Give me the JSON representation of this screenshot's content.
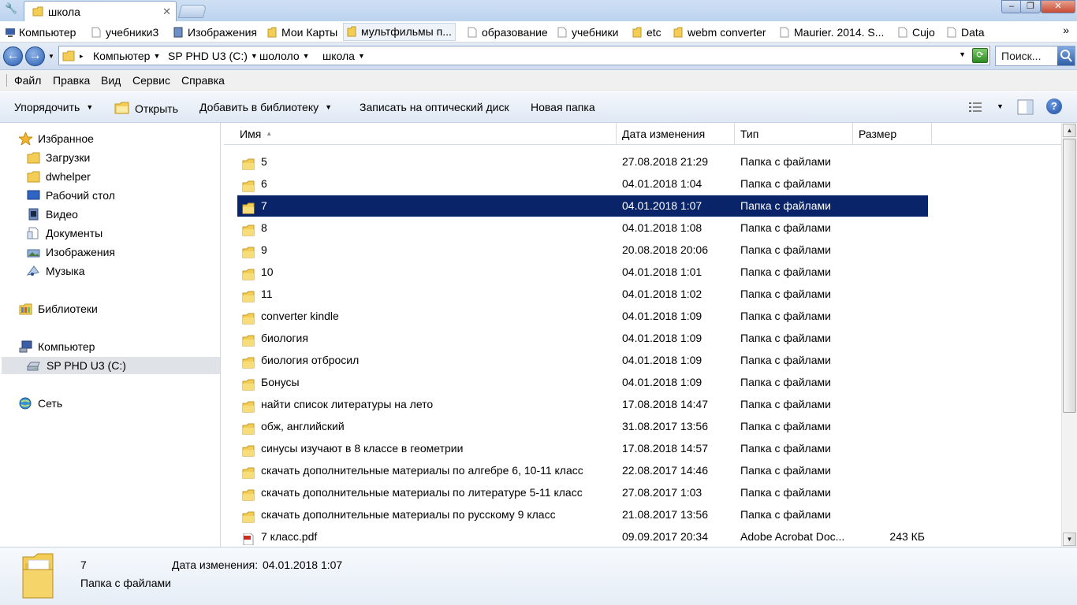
{
  "tab": {
    "title": "школа"
  },
  "bookmarks": [
    {
      "label": "Компьютер",
      "icon": "computer-icon"
    },
    {
      "label": "учебники3",
      "icon": "page-icon"
    },
    {
      "label": "Изображения",
      "icon": "pictures-icon"
    },
    {
      "label": "Мои Карты",
      "icon": "folder-icon"
    },
    {
      "label": "мультфильмы п...",
      "icon": "folder-icon"
    },
    {
      "label": "образование",
      "icon": "page-icon"
    },
    {
      "label": "учебники",
      "icon": "page-icon"
    },
    {
      "label": "etc",
      "icon": "folder-icon"
    },
    {
      "label": "webm converter",
      "icon": "folder-icon"
    },
    {
      "label": "Maurier. 2014. S...",
      "icon": "page-icon"
    },
    {
      "label": "Cujo",
      "icon": "page-icon"
    },
    {
      "label": "Data",
      "icon": "page-icon"
    }
  ],
  "bookmarks_more": "»",
  "address": {
    "crumbs": [
      "Компьютер",
      "SP PHD U3 (C:)",
      "шололо",
      "школа"
    ],
    "search_placeholder": "Поиск..."
  },
  "menu": [
    "Файл",
    "Правка",
    "Вид",
    "Сервис",
    "Справка"
  ],
  "commands": {
    "organize": "Упорядочить",
    "open": "Открыть",
    "add_library": "Добавить в библиотеку",
    "burn": "Записать на оптический диск",
    "new_folder": "Новая папка",
    "help": "?"
  },
  "nav": {
    "favorites": "Избранное",
    "favorites_items": [
      "Загрузки",
      "dwhelper",
      "Рабочий стол",
      "Видео",
      "Документы",
      "Изображения",
      "Музыка"
    ],
    "libraries": "Библиотеки",
    "computer": "Компьютер",
    "drive": "SP PHD U3 (C:)",
    "network": "Сеть"
  },
  "columns": {
    "name": "Имя",
    "date": "Дата изменения",
    "type": "Тип",
    "size": "Размер"
  },
  "files": [
    {
      "name": "5",
      "date": "27.08.2018 21:29",
      "type": "Папка с файлами",
      "size": "",
      "kind": "folder"
    },
    {
      "name": "6",
      "date": "04.01.2018 1:04",
      "type": "Папка с файлами",
      "size": "",
      "kind": "folder"
    },
    {
      "name": "7",
      "date": "04.01.2018 1:07",
      "type": "Папка с файлами",
      "size": "",
      "kind": "folder",
      "selected": true
    },
    {
      "name": "8",
      "date": "04.01.2018 1:08",
      "type": "Папка с файлами",
      "size": "",
      "kind": "folder"
    },
    {
      "name": "9",
      "date": "20.08.2018 20:06",
      "type": "Папка с файлами",
      "size": "",
      "kind": "folder"
    },
    {
      "name": "10",
      "date": "04.01.2018 1:01",
      "type": "Папка с файлами",
      "size": "",
      "kind": "folder"
    },
    {
      "name": "11",
      "date": "04.01.2018 1:02",
      "type": "Папка с файлами",
      "size": "",
      "kind": "folder"
    },
    {
      "name": "converter kindle",
      "date": "04.01.2018 1:09",
      "type": "Папка с файлами",
      "size": "",
      "kind": "folder"
    },
    {
      "name": "биология",
      "date": "04.01.2018 1:09",
      "type": "Папка с файлами",
      "size": "",
      "kind": "folder"
    },
    {
      "name": "биология отбросил",
      "date": "04.01.2018 1:09",
      "type": "Папка с файлами",
      "size": "",
      "kind": "folder"
    },
    {
      "name": "Бонусы",
      "date": "04.01.2018 1:09",
      "type": "Папка с файлами",
      "size": "",
      "kind": "folder"
    },
    {
      "name": "найти список литературы на лето",
      "date": "17.08.2018 14:47",
      "type": "Папка с файлами",
      "size": "",
      "kind": "folder"
    },
    {
      "name": "обж, английский",
      "date": "31.08.2017 13:56",
      "type": "Папка с файлами",
      "size": "",
      "kind": "folder"
    },
    {
      "name": "синусы изучают в 8 классе в геометрии",
      "date": "17.08.2018 14:57",
      "type": "Папка с файлами",
      "size": "",
      "kind": "folder"
    },
    {
      "name": "скачать дополнительные материалы по алгебре 6, 10-11 класс",
      "date": "22.08.2017 14:46",
      "type": "Папка с файлами",
      "size": "",
      "kind": "folder"
    },
    {
      "name": "скачать дополнительные материалы по литературе 5-11 класс",
      "date": "27.08.2017 1:03",
      "type": "Папка с файлами",
      "size": "",
      "kind": "folder"
    },
    {
      "name": "скачать дополнительные материалы по русскому 9 класс",
      "date": "21.08.2017 13:56",
      "type": "Папка с файлами",
      "size": "",
      "kind": "folder"
    },
    {
      "name": "7 класс.pdf",
      "date": "09.09.2017 20:34",
      "type": "Adobe Acrobat Doc...",
      "size": "243 КБ",
      "kind": "pdf"
    }
  ],
  "details": {
    "name": "7",
    "date_label": "Дата изменения:",
    "date_value": "04.01.2018 1:07",
    "type": "Папка с файлами"
  },
  "colors": {
    "selection": "#0a246a",
    "accent": "#2a5eb1"
  }
}
